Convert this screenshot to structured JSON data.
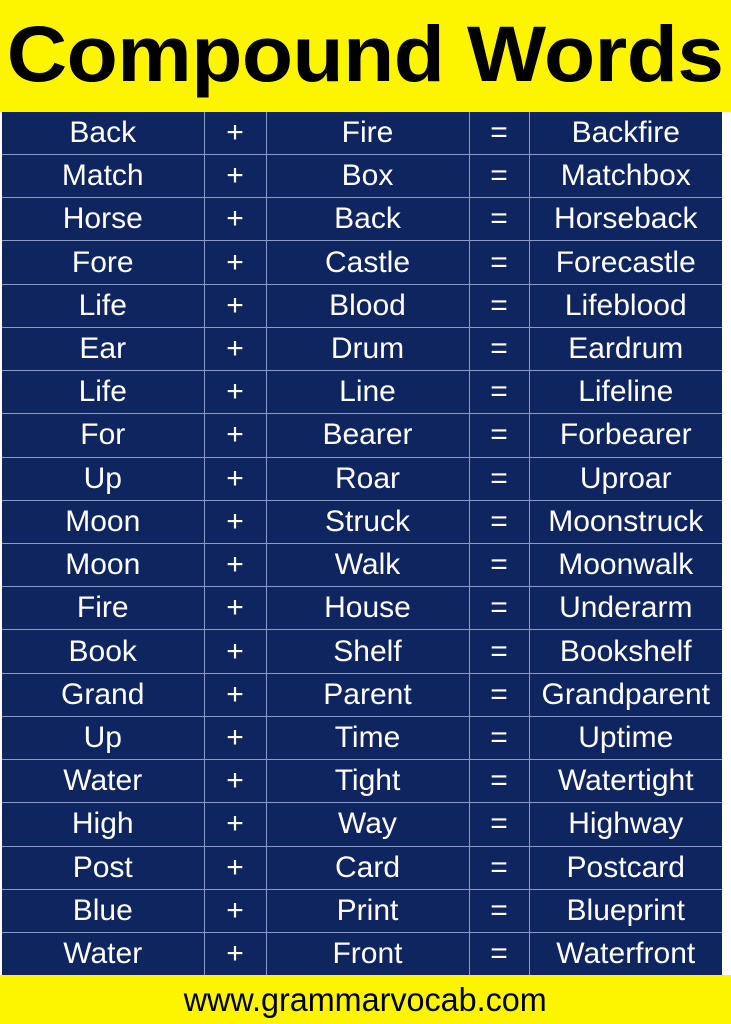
{
  "title": "Compound Words",
  "footer": {
    "website": "www.grammarvocab.com"
  },
  "colors": {
    "banner_background": "#fdf500",
    "table_background": "#0f2560",
    "table_gridline": "#8c9ac4",
    "table_text": "#ffffff",
    "title_text": "#000000"
  },
  "operators": {
    "plus": "+",
    "equals": "="
  },
  "table": {
    "rows": [
      {
        "word1": "Back",
        "op": "+",
        "word2": "Fire",
        "eq": "=",
        "result": "Backfire"
      },
      {
        "word1": "Match",
        "op": "+",
        "word2": "Box",
        "eq": "=",
        "result": "Matchbox"
      },
      {
        "word1": "Horse",
        "op": "+",
        "word2": "Back",
        "eq": "=",
        "result": "Horseback"
      },
      {
        "word1": "Fore",
        "op": "+",
        "word2": "Castle",
        "eq": "=",
        "result": "Forecastle"
      },
      {
        "word1": "Life",
        "op": "+",
        "word2": "Blood",
        "eq": "=",
        "result": "Lifeblood"
      },
      {
        "word1": "Ear",
        "op": "+",
        "word2": "Drum",
        "eq": "=",
        "result": "Eardrum"
      },
      {
        "word1": "Life",
        "op": "+",
        "word2": "Line",
        "eq": "=",
        "result": "Lifeline"
      },
      {
        "word1": "For",
        "op": "+",
        "word2": "Bearer",
        "eq": "=",
        "result": "Forbearer"
      },
      {
        "word1": "Up",
        "op": "+",
        "word2": "Roar",
        "eq": "=",
        "result": "Uproar"
      },
      {
        "word1": "Moon",
        "op": "+",
        "word2": "Struck",
        "eq": "=",
        "result": "Moonstruck"
      },
      {
        "word1": "Moon",
        "op": "+",
        "word2": "Walk",
        "eq": "=",
        "result": "Moonwalk"
      },
      {
        "word1": "Fire",
        "op": "+",
        "word2": "House",
        "eq": "=",
        "result": "Underarm"
      },
      {
        "word1": "Book",
        "op": "+",
        "word2": "Shelf",
        "eq": "=",
        "result": "Bookshelf"
      },
      {
        "word1": "Grand",
        "op": "+",
        "word2": "Parent",
        "eq": "=",
        "result": "Grandparent"
      },
      {
        "word1": "Up",
        "op": "+",
        "word2": "Time",
        "eq": "=",
        "result": "Uptime"
      },
      {
        "word1": "Water",
        "op": "+",
        "word2": "Tight",
        "eq": "=",
        "result": "Watertight"
      },
      {
        "word1": "High",
        "op": "+",
        "word2": "Way",
        "eq": "=",
        "result": "Highway"
      },
      {
        "word1": "Post",
        "op": "+",
        "word2": "Card",
        "eq": "=",
        "result": "Postcard"
      },
      {
        "word1": "Blue",
        "op": "+",
        "word2": "Print",
        "eq": "=",
        "result": "Blueprint"
      },
      {
        "word1": "Water",
        "op": "+",
        "word2": "Front",
        "eq": "=",
        "result": "Waterfront"
      }
    ]
  }
}
